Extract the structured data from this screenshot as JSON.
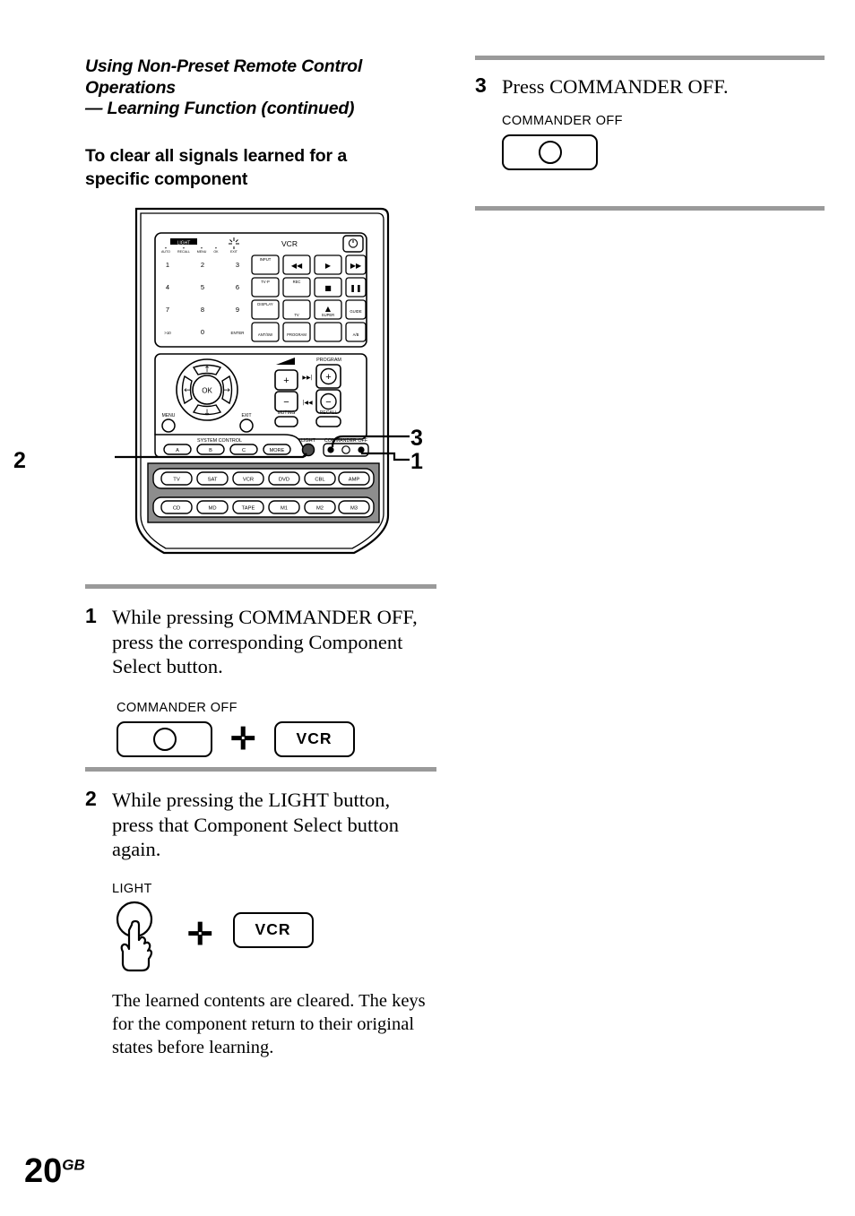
{
  "page": {
    "number": "20",
    "number_suffix": "GB"
  },
  "left_column": {
    "chapter_title_line1": "Using Non-Preset Remote Control",
    "chapter_title_line2": "Operations",
    "chapter_title_line3": "— Learning Function (continued)",
    "section_title_line1": "To clear all signals learned for a",
    "section_title_line2": "specific component",
    "callouts": {
      "one": "1",
      "two": "2",
      "three": "3"
    },
    "step1": {
      "number": "1",
      "text": "While pressing COMMANDER OFF, press the corresponding Component Select button.",
      "caption": "COMMANDER OFF",
      "plus": "✛",
      "key_label": "VCR"
    },
    "step2": {
      "number": "2",
      "text": "While pressing the LIGHT button, press that Component Select button again.",
      "caption": "LIGHT",
      "plus": "✛",
      "key_label": "VCR"
    },
    "closing_text": "The learned contents are cleared. The keys for the component return to their original states before learning."
  },
  "right_column": {
    "step3": {
      "number": "3",
      "text": "Press COMMANDER OFF.",
      "caption": "COMMANDER OFF"
    }
  },
  "remote": {
    "display": {
      "badge": "LIGHT",
      "mode_label": "VCR",
      "indicators": [
        "AUTO",
        "RECALL",
        "MENU",
        "OK",
        "EXIT"
      ]
    },
    "power_icon": "⏻",
    "numeric_keys": [
      "1",
      "2",
      "3",
      "4",
      "5",
      "6",
      "7",
      "8",
      "9",
      ">10",
      "0",
      "ENTER"
    ],
    "function_keys": [
      [
        "INPUT",
        "◀◀",
        "▶",
        "▶▶"
      ],
      [
        "TV·P",
        "REC",
        "■",
        "❚❚"
      ],
      [
        "DISPLAY",
        "TV",
        "▲",
        "GUIDE"
      ],
      [
        "ANT/SW",
        "PROGRAM",
        "SUPER",
        "A/B"
      ]
    ],
    "navigation": {
      "ok": "OK",
      "menu": "MENU",
      "exit": "EXIT",
      "up": "↑",
      "down": "↓",
      "left": "←",
      "right": "→"
    },
    "volume": {
      "plus": "+",
      "minus": "−",
      "muting": "MUTING"
    },
    "program": {
      "title": "PROGRAM",
      "plus": "+",
      "minus": "−",
      "recall": "RECALL",
      "next": "▶▶|",
      "prev": "|◀◀"
    },
    "system_control": {
      "title": "SYSTEM CONTROL",
      "keys": [
        "A",
        "B",
        "C",
        "MORE"
      ]
    },
    "light_label": "LIGHT",
    "commander_off_label": "COMMANDER OFF",
    "component_row1": [
      "TV",
      "SAT",
      "VCR",
      "DVD",
      "CBL",
      "AMP"
    ],
    "component_row2": [
      "CD",
      "MD",
      "TAPE",
      "M1",
      "M2",
      "M3"
    ]
  },
  "colors": {
    "rule": "#9a9a9a",
    "panel": "#8d8d8d",
    "ink": "#000000",
    "paper": "#ffffff"
  }
}
